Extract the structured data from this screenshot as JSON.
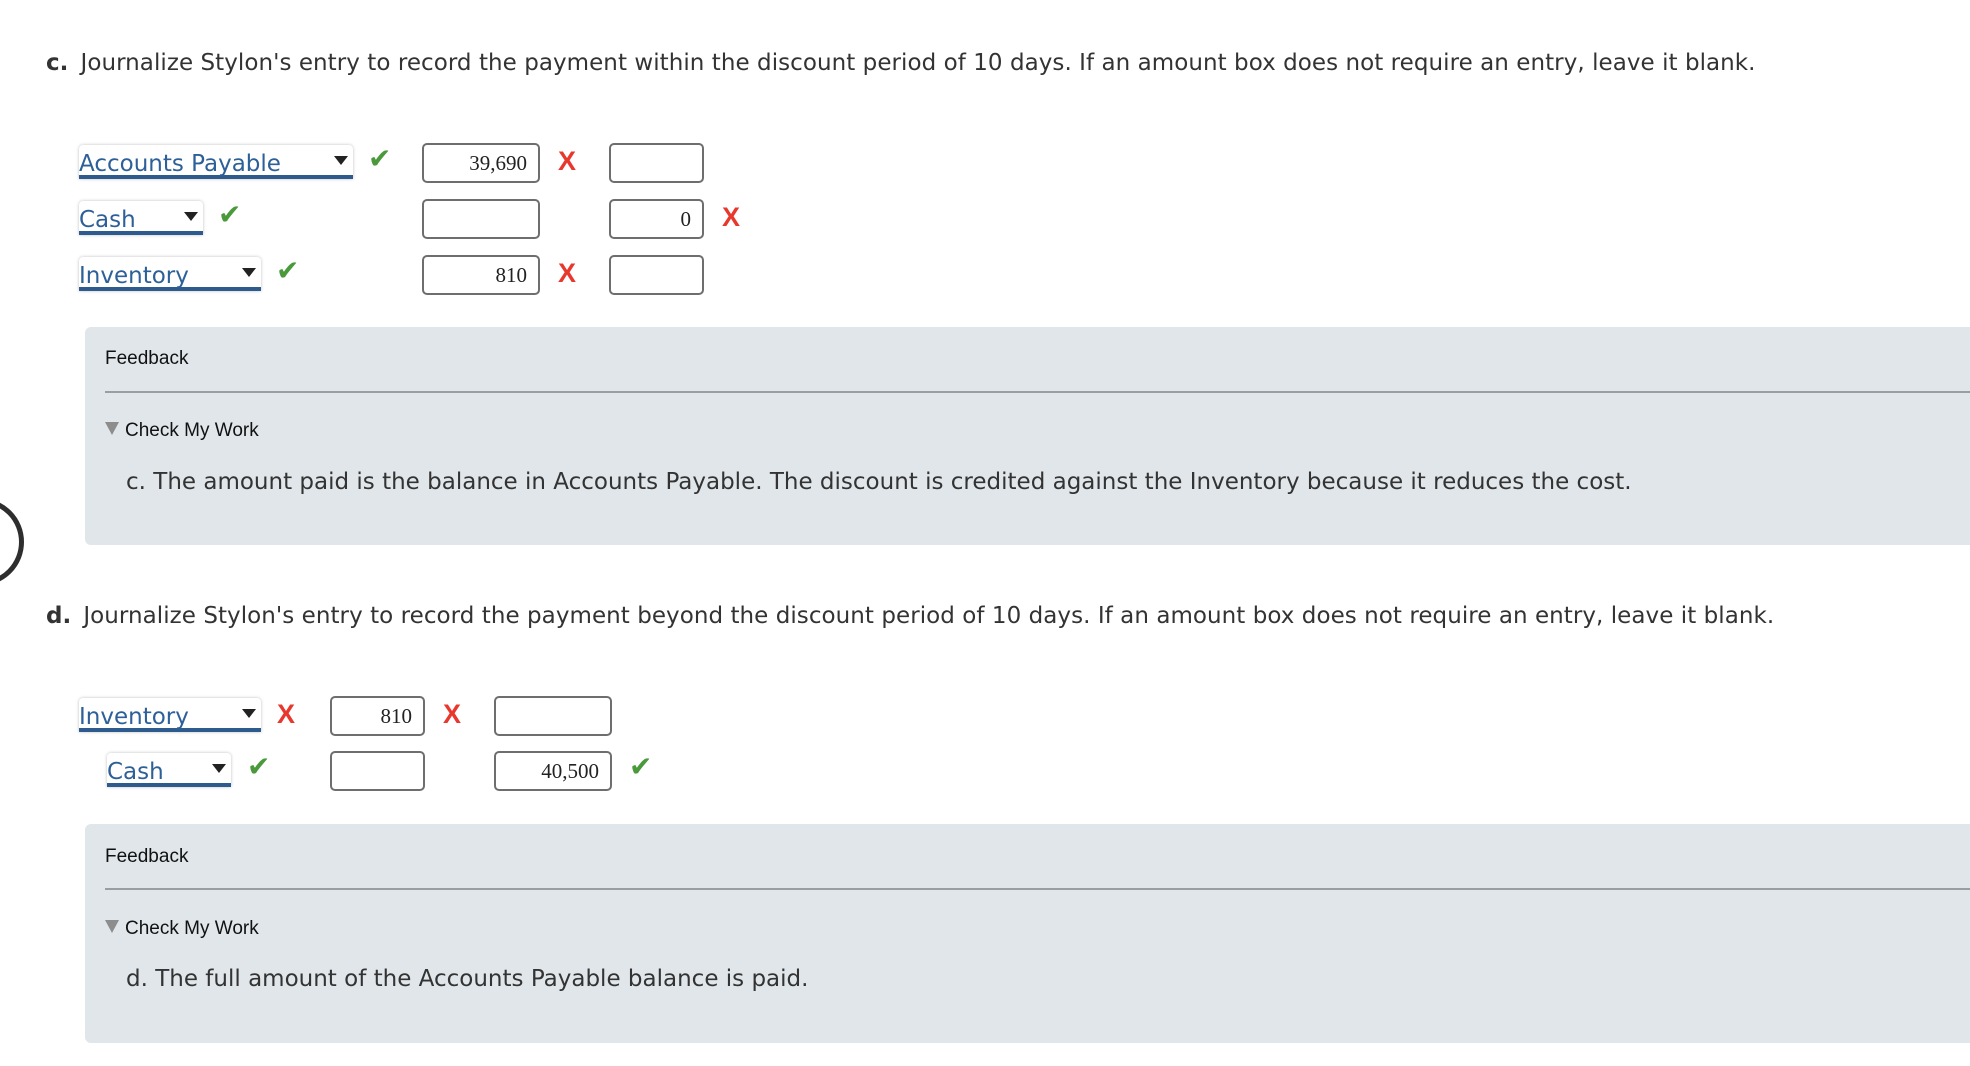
{
  "part_c": {
    "letter": "c.",
    "instruction": "Journalize Stylon's entry to record the payment within the discount period of 10 days. If an amount box does not require an entry, leave it blank.",
    "rows": [
      {
        "account": "Accounts Payable",
        "account_status": "correct",
        "debit": "39,690",
        "debit_status": "incorrect",
        "credit": "",
        "credit_status": "none"
      },
      {
        "account": "Cash",
        "account_status": "correct",
        "debit": "",
        "debit_status": "none",
        "credit": "0",
        "credit_status": "incorrect"
      },
      {
        "account": "Inventory",
        "account_status": "correct",
        "debit": "810",
        "debit_status": "incorrect",
        "credit": "",
        "credit_status": "none"
      }
    ],
    "feedback": {
      "label": "Feedback",
      "toggle_label": "Check My Work",
      "text": "c. The amount paid is the balance in Accounts Payable. The discount is credited against the Inventory because it reduces the cost."
    }
  },
  "part_d": {
    "letter": "d.",
    "instruction": "Journalize Stylon's entry to record the payment beyond the discount period of 10 days. If an amount box does not require an entry, leave it blank.",
    "rows": [
      {
        "account": "Inventory",
        "account_status": "incorrect",
        "debit": "810",
        "debit_status": "incorrect",
        "credit": "",
        "credit_status": "none"
      },
      {
        "account": "Cash",
        "account_status": "correct",
        "debit": "",
        "debit_status": "none",
        "credit": "40,500",
        "credit_status": "correct"
      }
    ],
    "feedback": {
      "label": "Feedback",
      "toggle_label": "Check My Work",
      "text": "d. The full amount of the Accounts Payable balance is paid."
    }
  },
  "icons": {
    "correct": "✔",
    "incorrect": "X"
  },
  "colors": {
    "correct": "#4a9a3c",
    "incorrect": "#e8382e",
    "account_link": "#2d6098",
    "feedback_bg": "#e0e6ea"
  }
}
